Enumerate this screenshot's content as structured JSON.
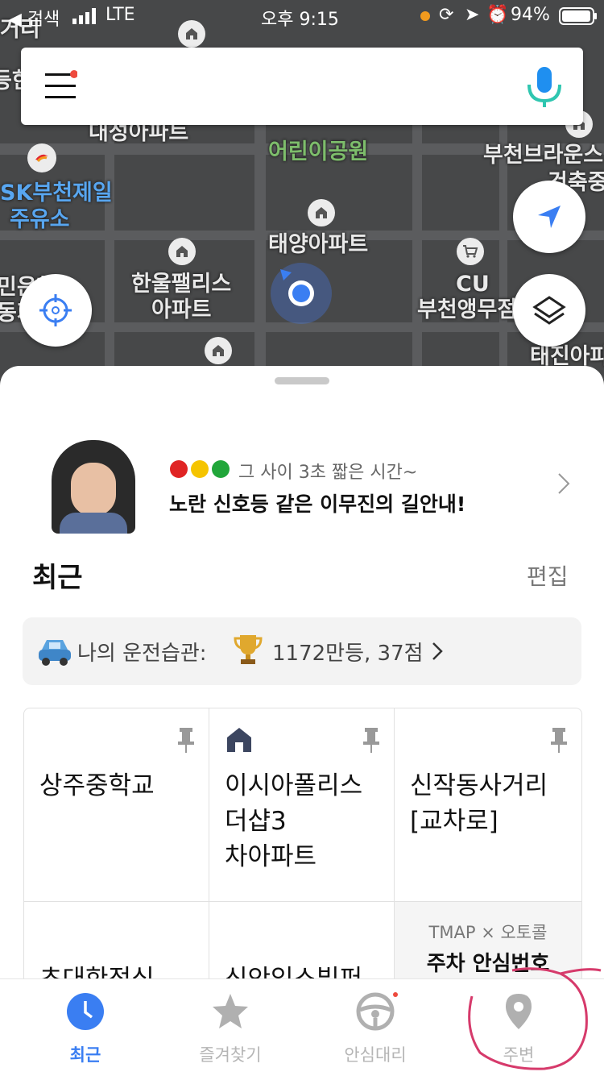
{
  "status_bar": {
    "back_label": "◀ 검색",
    "carrier": "LTE",
    "time": "오후 9:15",
    "battery": "94%"
  },
  "map": {
    "labels": [
      {
        "text": "대성아파트",
        "style": "white"
      },
      {
        "text": "어린이공원",
        "style": "green"
      },
      {
        "text": "SK부천제일",
        "style": "blue"
      },
      {
        "text": "주유소",
        "style": "blue"
      },
      {
        "text": "태양아파트",
        "style": "white"
      },
      {
        "text": "한울팰리스",
        "style": "white"
      },
      {
        "text": "아파트",
        "style": "white"
      },
      {
        "text": "CU",
        "style": "white"
      },
      {
        "text": "부천앵무점",
        "style": "white"
      },
      {
        "text": "부천브라운스",
        "style": "white"
      },
      {
        "text": "건축중",
        "style": "white"
      },
      {
        "text": "태진아파",
        "style": "white"
      },
      {
        "text": "등한",
        "style": "white"
      },
      {
        "text": "거리",
        "style": "white"
      },
      {
        "text": "민은행",
        "style": "white"
      },
      {
        "text": "동지",
        "style": "white"
      }
    ]
  },
  "search": {
    "menu_icon": "hamburger-icon",
    "mic_icon": "mic-icon"
  },
  "banner": {
    "line1": "그 사이 3초 짧은 시간~",
    "line2": "노란 신호등 같은 이무진의 길안내!"
  },
  "recent": {
    "title": "최근",
    "edit_label": "편집"
  },
  "driving": {
    "prefix": "나의 운전습관:",
    "value": "1172만등, 37점"
  },
  "places": [
    {
      "name": "상주중학교",
      "home": false
    },
    {
      "name": "이시아폴리스\n더샵3\n차아파트",
      "home": true
    },
    {
      "name": "신작동사거리\n[교차로]",
      "home": false
    },
    {
      "name": "초대한정식",
      "home": false
    },
    {
      "name": "신안익스빌퍼",
      "home": false
    }
  ],
  "promo": {
    "brand": "TMAP × 오토콜",
    "text": "주차 안심번호"
  },
  "tabs": [
    {
      "label": "최근",
      "icon": "clock-icon",
      "active": true
    },
    {
      "label": "즐겨찾기",
      "icon": "star-icon",
      "active": false
    },
    {
      "label": "안심대리",
      "icon": "steering-wheel-icon",
      "active": false
    },
    {
      "label": "주변",
      "icon": "location-pin-icon",
      "active": false
    }
  ],
  "colors": {
    "accent": "#3a7ef2",
    "notification_dot": "#ee4a3e",
    "annotation": "#d63a6b"
  }
}
